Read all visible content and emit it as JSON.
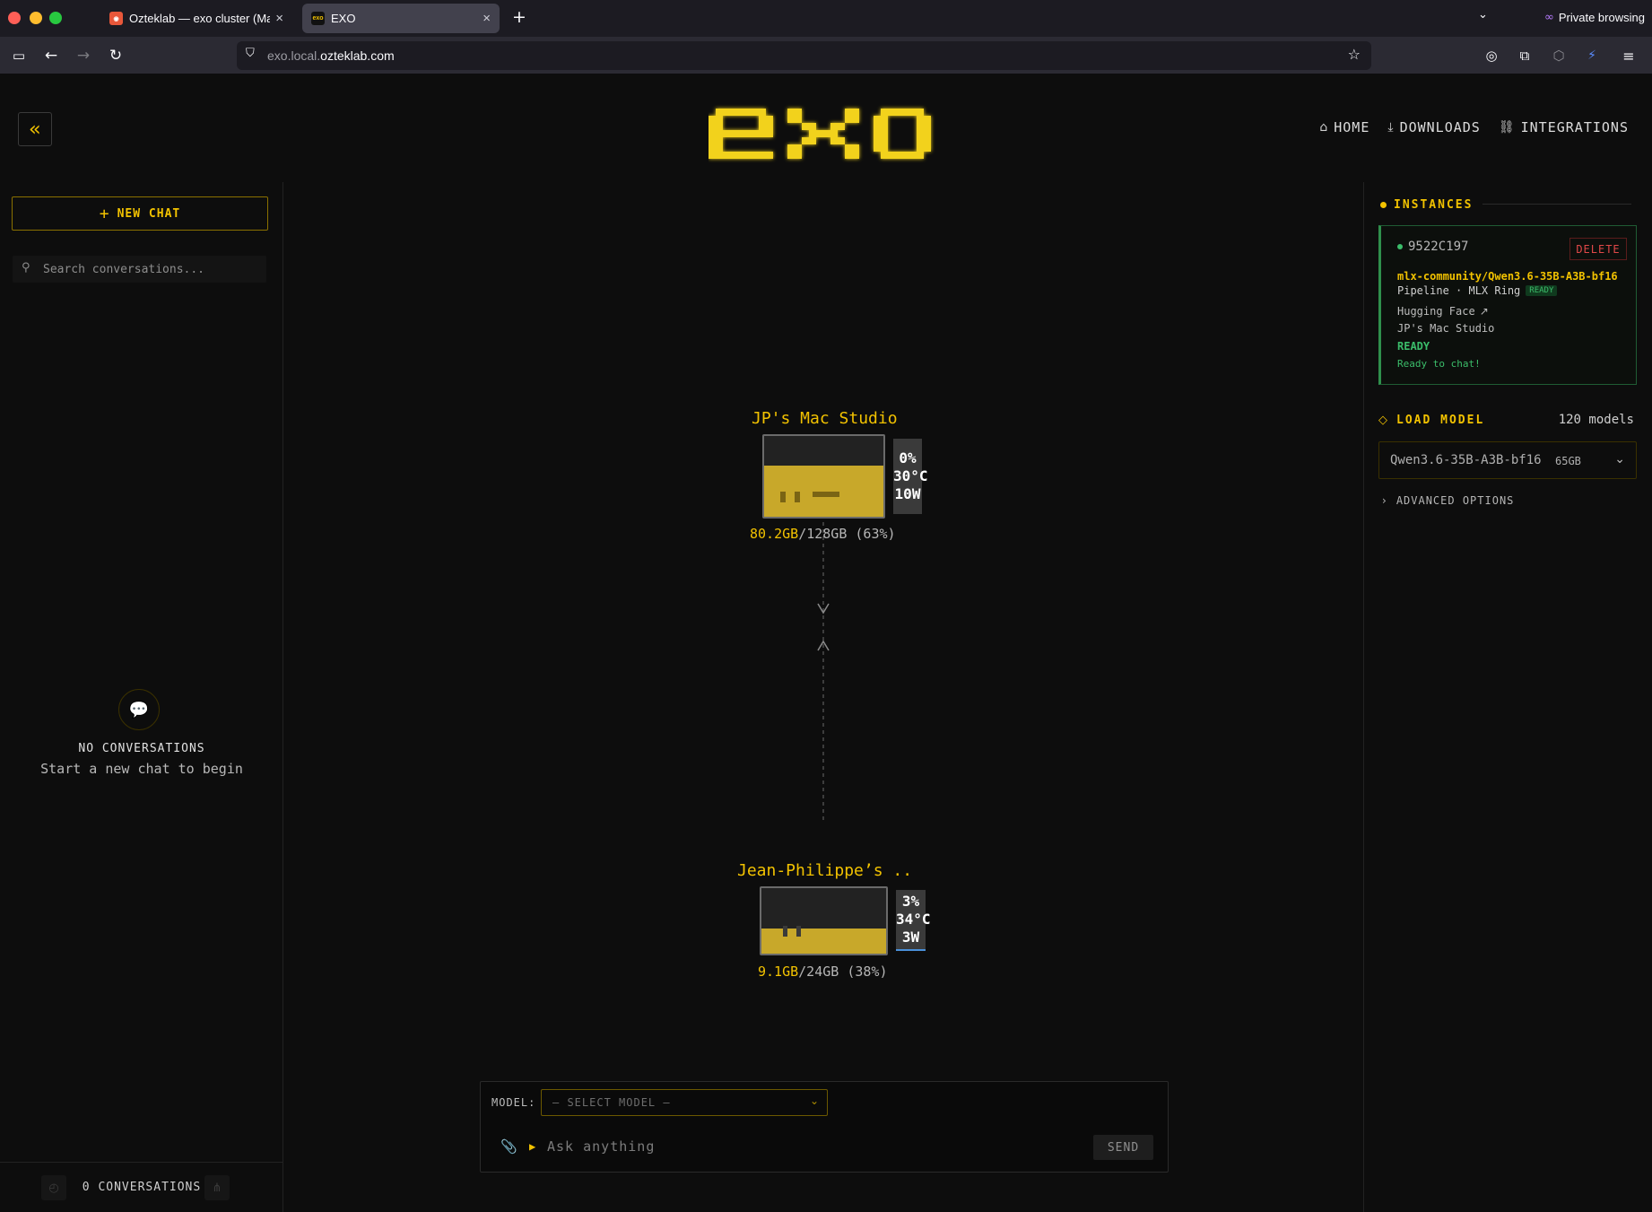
{
  "browser": {
    "tabs": [
      {
        "title": "Ozteklab — exo cluster (Mac ML",
        "active": false
      },
      {
        "title": "EXO",
        "favicon_text": "exo",
        "active": true
      }
    ],
    "private_label": "Private browsing",
    "url_prefix": "exo.local.",
    "url_domain": "ozteklab.com"
  },
  "header": {
    "logo_text": "exo",
    "nav": [
      {
        "label": "HOME",
        "icon": "home-icon"
      },
      {
        "label": "DOWNLOADS",
        "icon": "download-icon"
      },
      {
        "label": "INTEGRATIONS",
        "icon": "link-icon"
      }
    ]
  },
  "sidebar": {
    "new_chat_label": "NEW CHAT",
    "search_placeholder": "Search conversations...",
    "empty_title": "NO CONVERSATIONS",
    "empty_subtitle": "Start a new chat to begin",
    "footer_count": "0 CONVERSATIONS"
  },
  "topology": {
    "nodes": [
      {
        "name": "JP's Mac Studio",
        "gpu": "0%",
        "temp": "30°C",
        "power": "10W",
        "mem_used": "80.2GB",
        "mem_total": "/128GB",
        "mem_pct": "(63%)",
        "fill_fraction": 0.63
      },
      {
        "name": "Jean-Philippe’s ..",
        "gpu": "3%",
        "temp": "34°C",
        "power": "3W",
        "mem_used": "9.1GB",
        "mem_total": "/24GB",
        "mem_pct": "(38%)",
        "fill_fraction": 0.38
      }
    ]
  },
  "chat": {
    "model_label": "MODEL:",
    "model_placeholder": "— SELECT MODEL —",
    "input_placeholder": "Ask anything",
    "send_label": "SEND"
  },
  "instances": {
    "heading": "INSTANCES",
    "items": [
      {
        "id": "9522C197",
        "delete_label": "DELETE",
        "model": "mlx-community/Qwen3.6-35B-A3B-bf16",
        "meta": "Pipeline · MLX Ring",
        "badge": "READY",
        "source": "Hugging Face",
        "node": "JP's Mac Studio",
        "state": "READY",
        "message": "Ready to chat!"
      }
    ]
  },
  "load_model": {
    "heading": "LOAD MODEL",
    "count": "120 models",
    "selected_model": "Qwen3.6-35B-A3B-bf16",
    "selected_size": "65GB",
    "advanced_label": "ADVANCED OPTIONS"
  },
  "colors": {
    "accent": "#f2c200",
    "ready_green": "#3bbd6a",
    "delete_red": "#e04848",
    "background": "#0d0d0d"
  }
}
